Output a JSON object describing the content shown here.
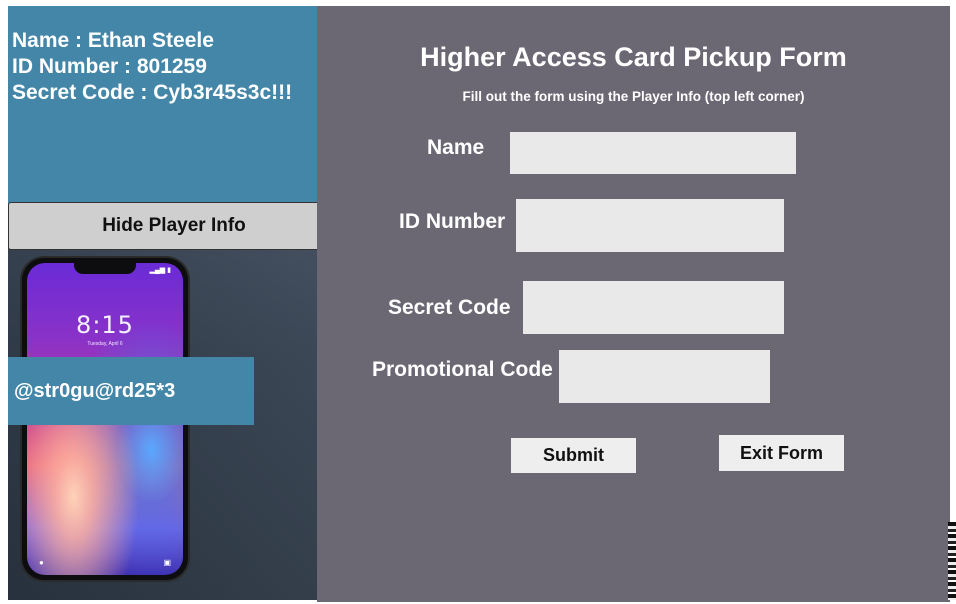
{
  "player_info": {
    "name_line": "Name : Ethan Steele",
    "id_line": "ID Number : 801259",
    "secret_line": "Secret Code : Cyb3r45s3c!!!"
  },
  "hide_button_label": "Hide Player Info",
  "phone": {
    "time": "8:15",
    "date": "Tuesday, April 6"
  },
  "promo_overlay_text": "@str0gu@rd25*3",
  "form": {
    "title": "Higher Access Card Pickup Form",
    "subtitle": "Fill out the form using the Player Info (top left corner)",
    "labels": {
      "name": "Name",
      "id_number": "ID Number",
      "secret_code": "Secret Code",
      "promo_code": "Promotional Code"
    },
    "values": {
      "name": "",
      "id_number": "",
      "secret_code": "",
      "promo_code": ""
    },
    "submit_label": "Submit",
    "exit_label": "Exit Form"
  },
  "colors": {
    "player_panel": "#4486a8",
    "form_panel": "#6b6874",
    "field_bg": "#e9e9e9"
  }
}
